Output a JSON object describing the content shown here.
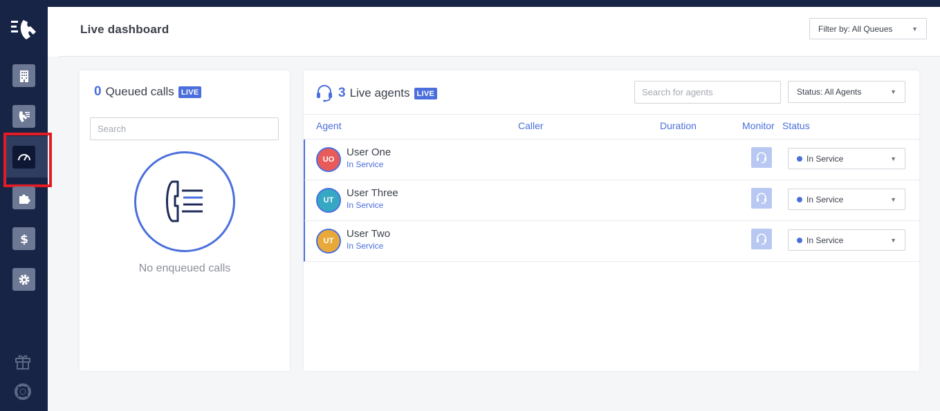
{
  "header": {
    "title": "Live dashboard",
    "filter_label": "Filter by: All Queues"
  },
  "queued": {
    "count": "0",
    "label": "Queued calls",
    "badge": "LIVE",
    "search_placeholder": "Search",
    "empty_text": "No enqueued calls"
  },
  "agents": {
    "count": "3",
    "label": "Live agents",
    "badge": "LIVE",
    "search_placeholder": "Search for agents",
    "status_filter": "Status: All Agents",
    "columns": {
      "agent": "Agent",
      "caller": "Caller",
      "duration": "Duration",
      "monitor": "Monitor",
      "status": "Status"
    },
    "rows": [
      {
        "initials": "UO",
        "name": "User One",
        "sub": "In Service",
        "status": "In Service",
        "avatar_color": "#e95b5b"
      },
      {
        "initials": "UT",
        "name": "User Three",
        "sub": "In Service",
        "status": "In Service",
        "avatar_color": "#36a8c4"
      },
      {
        "initials": "UT",
        "name": "User Two",
        "sub": "In Service",
        "status": "In Service",
        "avatar_color": "#e8a93a"
      }
    ]
  },
  "colors": {
    "sidebar": "#172446",
    "accent": "#4a6fdc",
    "highlight": "#e31b23"
  },
  "sidebar": {
    "icons": [
      "logo-icon",
      "building-icon",
      "call-queue-icon",
      "dashboard-gauge-icon",
      "puzzle-icon",
      "dollar-icon",
      "gear-icon",
      "gift-icon",
      "lifebuoy-icon"
    ]
  }
}
